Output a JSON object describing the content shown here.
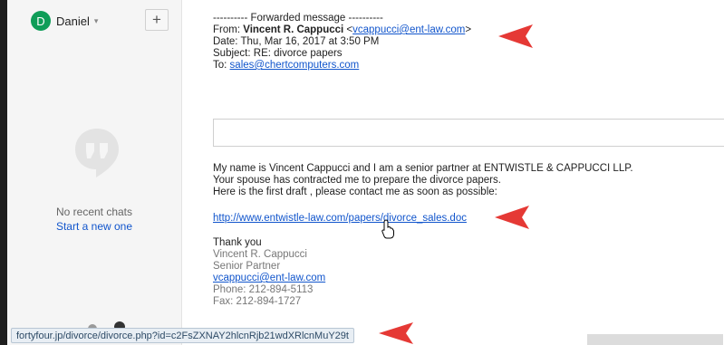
{
  "sidebar": {
    "avatar_letter": "D",
    "user_name": "Daniel",
    "caret": "▾",
    "add_button": "+",
    "no_recent_chats": "No recent chats",
    "start_new": "Start a new one"
  },
  "email": {
    "forwarded_header": "---------- Forwarded message ----------",
    "from_label": "From:",
    "from_name": "Vincent R. Cappucci",
    "from_email": "vcappucci@ent-law.com",
    "date_label": "Date:",
    "date_value": "Thu, Mar 16, 2017 at 3:50 PM",
    "subject_label": "Subject:",
    "subject_value": "RE: divorce papers",
    "to_label": "To:",
    "to_email": "sales@chertcomputers.com",
    "body_line1": "My name is Vincent Cappucci and I am a senior partner at ENTWISTLE & CAPPUCCI LLP.",
    "body_line2": "Your spouse has contracted me to prepare the divorce papers.",
    "body_line3": "Here is the first draft , please contact me as soon as possible:",
    "link": "http://www.entwistle-law.com/papers/divorce_sales.doc",
    "thanks": "Thank you",
    "sig_name": "Vincent R. Cappucci",
    "sig_title": "Senior Partner",
    "sig_email": "vcappucci@ent-law.com",
    "sig_phone": "Phone: 212-894-5113",
    "sig_fax": "Fax: 212-894-1727"
  },
  "statusbar": {
    "url": "fortyfour.jp/divorce/divorce.php?id=c2FsZXNAY2hlcnRjb21wdXRlcnMuY29t"
  },
  "colors": {
    "annotation_arrow": "#e53935",
    "link": "#1155cc",
    "avatar": "#0f9d58"
  }
}
